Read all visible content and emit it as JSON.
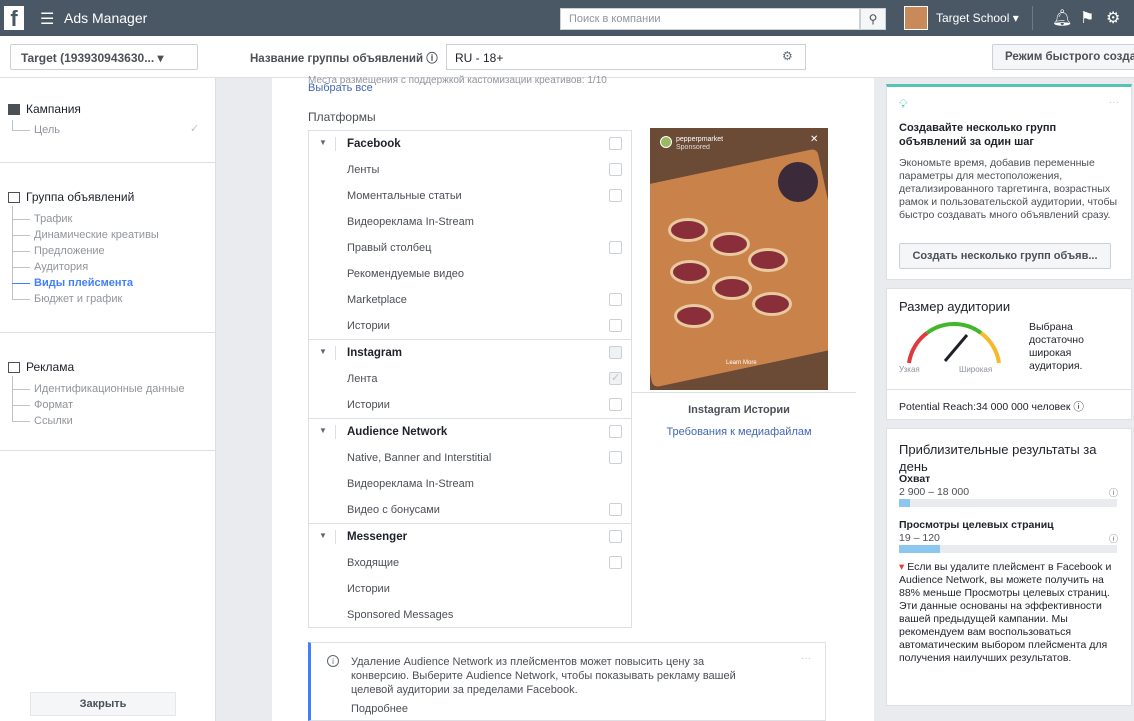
{
  "topbar": {
    "logo": "f",
    "menu_icon": "☰",
    "app_name": "Ads Manager",
    "search_placeholder": "Поиск в компании",
    "account_name": "Target School ▾"
  },
  "toolbar": {
    "account_select": "Target (193930943630... ▾",
    "adset_name_label": "Название группы объявлений ⓘ",
    "adset_name_value": "RU - 18+",
    "quick_mode_button": "Режим быстрого созда"
  },
  "sidebar": {
    "campaign": {
      "label": "Кампания",
      "items": [
        "Цель"
      ]
    },
    "adset": {
      "label": "Группа объявлений",
      "items": [
        "Трафик",
        "Динамические креативы",
        "Предложение",
        "Аудитория",
        "Виды плейсмента",
        "Бюджет и график"
      ],
      "active_index": 4
    },
    "ad": {
      "label": "Реклама",
      "items": [
        "Идентификационные данные",
        "Формат",
        "Ссылки"
      ]
    },
    "close_button": "Закрыть"
  },
  "main": {
    "cut_text": "Места размещения с поддержкой кастомизации креативов: 1/10",
    "select_all": "Выбрать все",
    "platforms_title": "Платформы",
    "groups": [
      {
        "name": "Facebook",
        "items": [
          "Ленты",
          "Моментальные статьи",
          "Видеореклама In-Stream",
          "Правый столбец",
          "Рекомендуемые видео",
          "Marketplace",
          "Истории"
        ]
      },
      {
        "name": "Instagram",
        "items": [
          "Лента",
          "Истории"
        ]
      },
      {
        "name": "Audience Network",
        "items": [
          "Native, Banner and Interstitial",
          "Видеореклама In-Stream",
          "Видео с бонусами"
        ]
      },
      {
        "name": "Messenger",
        "items": [
          "Входящие",
          "Истории",
          "Sponsored Messages"
        ]
      }
    ],
    "preview": {
      "account": "pepperpmarket",
      "sponsored": "Sponsored",
      "cta": "Learn More",
      "caption": "Instagram Истории",
      "media_link": "Требования к медиафайлам"
    },
    "notice": {
      "text": "Удаление Audience Network из плейсментов может повысить цену за конверсию. Выберите Audience Network, чтобы показывать рекламу вашей целевой аудитории за пределами Facebook.",
      "more": "Подробнее"
    }
  },
  "right": {
    "tip": {
      "title": "Создавайте несколько групп объявлений за один шаг",
      "body": "Экономьте время, добавив переменные параметры для местоположения, детализированного таргетинга, возрастных рамок и пользовательской аудитории, чтобы быстро создавать много объявлений сразу.",
      "button": "Создать несколько групп объяв..."
    },
    "audience": {
      "title": "Размер аудитории",
      "narrow": "Узкая",
      "wide": "Широкая",
      "description": "Выбрана достаточно широкая аудитория.",
      "reach": "Potential Reach:34 000 000 человек"
    },
    "results": {
      "title": "Приблизительные результаты за день",
      "reach_label": "Охват",
      "reach_value": "2 900 – 18 000",
      "reach_fraction": 0.05,
      "views_label": "Просмотры целевых страниц",
      "views_value": "19 – 120",
      "views_fraction": 0.19,
      "note": "Если вы удалите плейсмент в Facebook и Audience Network, вы можете получить на 88% меньше Просмотры целевых страниц. Эти данные основаны на эффективности вашей предыдущей кампании. Мы рекомендуем вам воспользоваться автоматическим выбором плейсмента для получения наилучших результатов."
    }
  }
}
